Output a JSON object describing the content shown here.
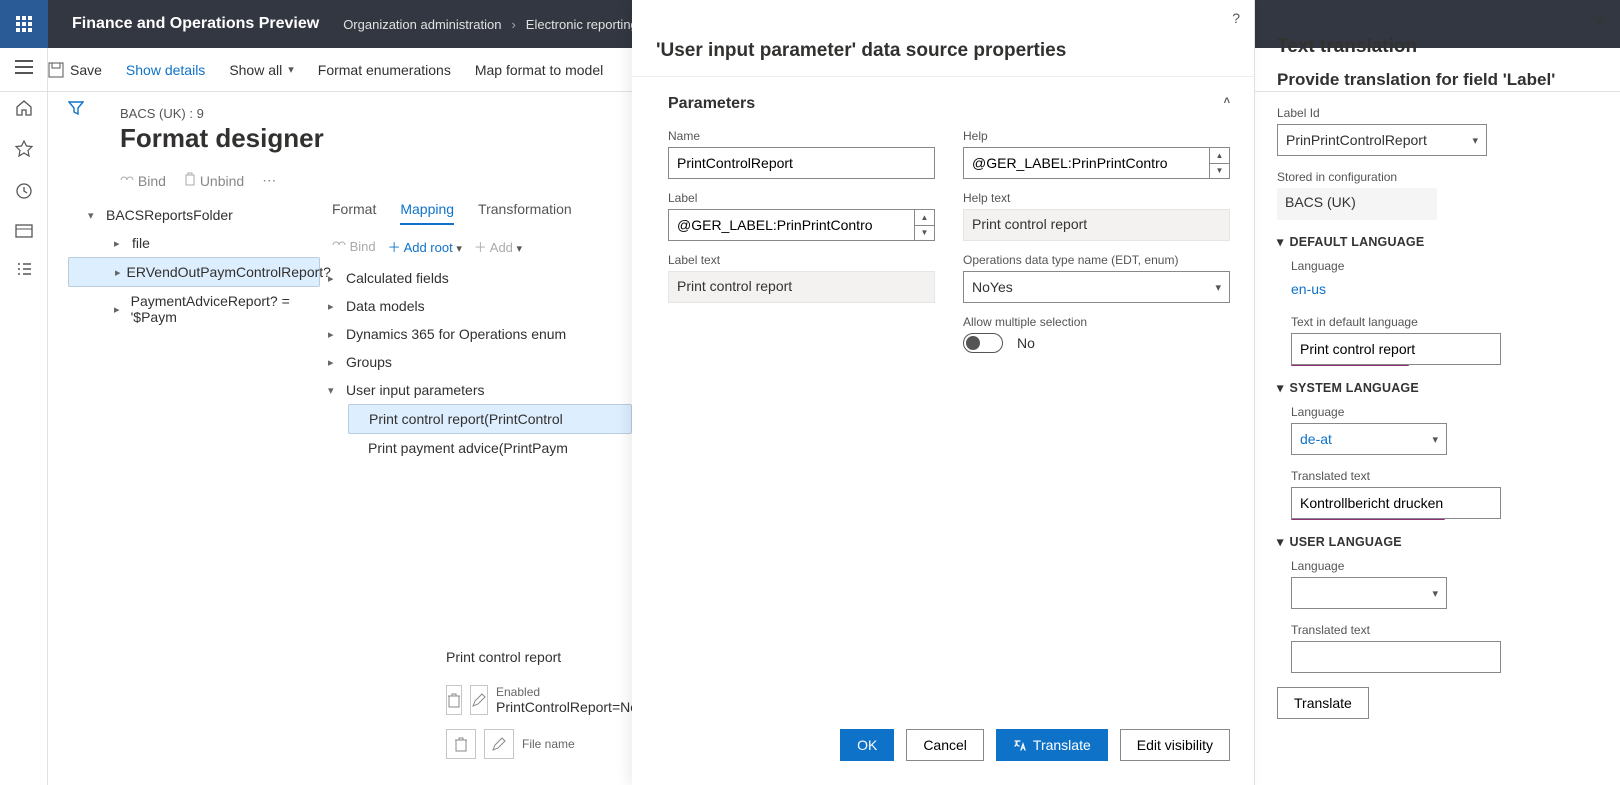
{
  "topbar": {
    "app_title": "Finance and Operations Preview",
    "bc1": "Organization administration",
    "bc2": "Electronic reporting"
  },
  "ribbon": {
    "save": "Save",
    "show_details": "Show details",
    "show_all": "Show all",
    "format_enum": "Format enumerations",
    "map_format": "Map format to model"
  },
  "page": {
    "breadcrumb": "BACS (UK) : 9",
    "title": "Format designer",
    "bind": "Bind",
    "unbind": "Unbind"
  },
  "left_tree": {
    "root": "BACSReportsFolder",
    "n1": "file",
    "n2": "ERVendOutPaymControlReport?",
    "n3": "PaymentAdviceReport? = '$Paym"
  },
  "tabs": {
    "t1": "Format",
    "t2": "Mapping",
    "t3": "Transformation"
  },
  "map_toolbar": {
    "bind": "Bind",
    "add_root": "Add root",
    "add": "Add"
  },
  "map_tree": {
    "n1": "Calculated fields",
    "n2": "Data models",
    "n3": "Dynamics 365 for Operations enum",
    "n4": "Groups",
    "n5": "User input parameters",
    "n5a": "Print control report(PrintControl",
    "n5b": "Print payment advice(PrintPaym"
  },
  "bottom": {
    "title": "Print control report",
    "enabled_l": "Enabled",
    "enabled_v": "PrintControlReport=NoYes.",
    "filename_l": "File name"
  },
  "props": {
    "title": "'User input parameter' data source properties",
    "section": "Parameters",
    "name_l": "Name",
    "name_v": "PrintControlReport",
    "label_l": "Label",
    "label_v": "@GER_LABEL:PrinPrintContro",
    "labeltext_l": "Label text",
    "labeltext_v": "Print control report",
    "help_l": "Help",
    "help_v": "@GER_LABEL:PrinPrintContro",
    "helptext_l": "Help text",
    "helptext_v": "Print control report",
    "edt_l": "Operations data type name (EDT, enum)",
    "edt_v": "NoYes",
    "allow_l": "Allow multiple selection",
    "allow_v": "No",
    "ok": "OK",
    "cancel": "Cancel",
    "translate": "Translate",
    "editvis": "Edit visibility"
  },
  "trans": {
    "title": "Text translation",
    "subtitle": "Provide translation for field 'Label'",
    "labelid_l": "Label Id",
    "labelid_v": "PrinPrintControlReport",
    "stored_l": "Stored in configuration",
    "stored_v": "BACS (UK)",
    "sec1": "DEFAULT LANGUAGE",
    "lang_l": "Language",
    "lang_def": "en-us",
    "text_def_l": "Text in default language",
    "text_def_v": "Print control report",
    "sec2": "SYSTEM LANGUAGE",
    "lang_sys": "de-at",
    "tt_l": "Translated text",
    "tt_v": "Kontrollbericht drucken",
    "sec3": "USER LANGUAGE",
    "btn": "Translate"
  }
}
